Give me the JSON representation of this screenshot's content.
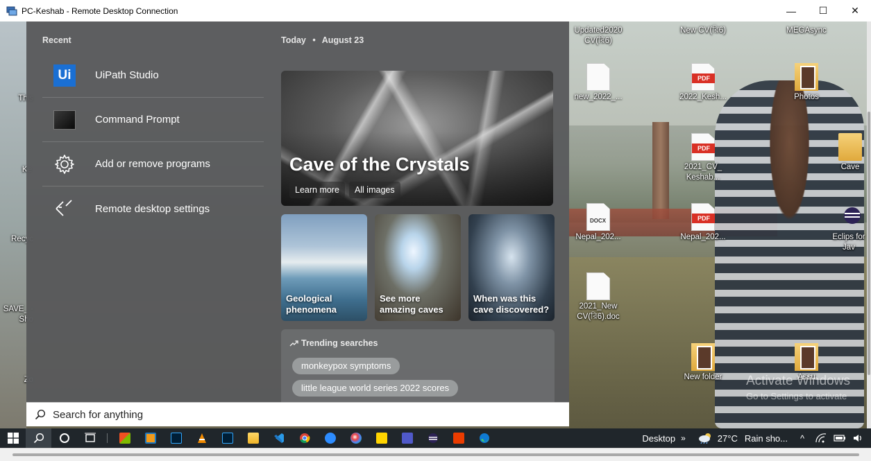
{
  "window": {
    "title": "PC-Keshab - Remote Desktop Connection",
    "controls": {
      "minimize": "—",
      "maximize": "☐",
      "close": "✕"
    }
  },
  "panel": {
    "recent_heading": "Recent",
    "recent_items": [
      {
        "label": "UiPath Studio",
        "icon": "uipath-icon",
        "icon_text": "Ui"
      },
      {
        "label": "Command Prompt",
        "icon": "command-prompt-icon"
      },
      {
        "label": "Add or remove programs",
        "icon": "gear-icon"
      },
      {
        "label": "Remote desktop settings",
        "icon": "remote-desktop-icon"
      }
    ],
    "today_label": "Today",
    "bullet": "•",
    "date": "August 23",
    "hero": {
      "title": "Cave of the Crystals",
      "learn_more": "Learn more",
      "all_images": "All images"
    },
    "cards": [
      {
        "caption": "Geological phenomena"
      },
      {
        "caption": "See more amazing caves"
      },
      {
        "caption": "When was this cave discovered?"
      }
    ],
    "trending": {
      "heading": "Trending searches",
      "chips": [
        "monkeypox symptoms",
        "little league world series 2022 scores"
      ]
    },
    "search": {
      "placeholder": "Search for anything"
    }
  },
  "desktop": {
    "icons": [
      {
        "label": "Updated2020 CV(রি6)",
        "kind": "none"
      },
      {
        "label": "New CV(রি6)",
        "kind": "none"
      },
      {
        "label": "MEGAsync",
        "kind": "none"
      },
      {
        "label": "new_2022_...",
        "kind": "doc"
      },
      {
        "label": "2022_Kesh...",
        "kind": "pdf"
      },
      {
        "label": "Photos",
        "kind": "photo"
      },
      {
        "label": "2021_CV_ Keshab...",
        "kind": "pdf"
      },
      {
        "label": "Cave",
        "kind": "folder"
      },
      {
        "label": "Nepal_202...",
        "kind": "docx"
      },
      {
        "label": "Nepal_202...",
        "kind": "pdf"
      },
      {
        "label": "Eclips for Jav",
        "kind": "app"
      },
      {
        "label": "2021_New CV(রি6).doc",
        "kind": "doc"
      },
      {
        "label": "New folder",
        "kind": "photo"
      },
      {
        "label": "Assu",
        "kind": "photo"
      }
    ],
    "left_labels": [
      "This",
      "Ke",
      "Recyc",
      "SAVE_ - Sho",
      "Zo"
    ],
    "pdf_tag": "PDF",
    "docx_tag": "DOCX",
    "watermark_line1": "Activate Windows",
    "watermark_line2": "Go to Settings to activate"
  },
  "taskbar": {
    "desktop_label": "Desktop",
    "overflow_chevron": "»",
    "temperature": "27°C",
    "condition": "Rain sho...",
    "up_chevron": "^",
    "apps": [
      "start",
      "search",
      "cortana",
      "task-view",
      "store",
      "vmware",
      "photoshop",
      "vlc",
      "photoshop-2",
      "file-explorer",
      "vscode",
      "chrome",
      "zoom",
      "paint",
      "sticky-notes",
      "teams",
      "eclipse",
      "office",
      "edge"
    ],
    "colors": {
      "accent": "#1a6fd3",
      "taskbar_bg": "#20262b"
    }
  }
}
